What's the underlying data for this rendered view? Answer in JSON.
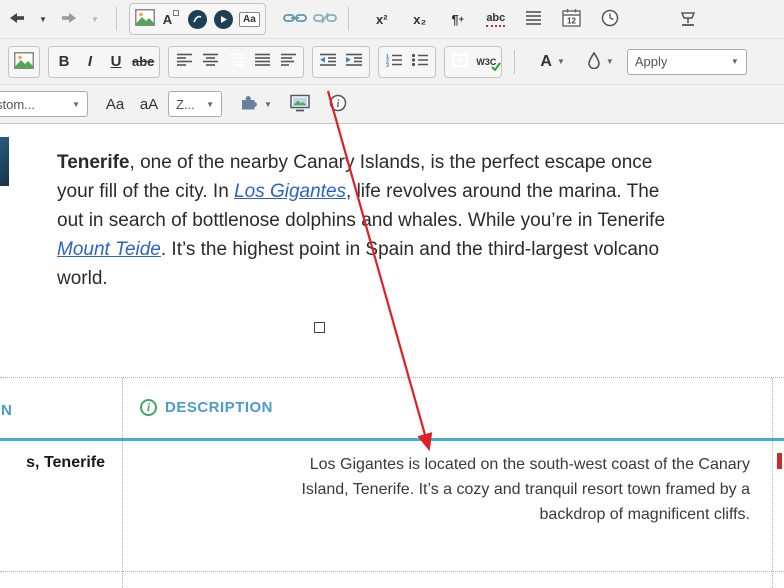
{
  "colors": {
    "toolbar_bg": "#f2f2f2",
    "active_teal": "#2ba5c9",
    "table_header_blue": "#4a9cc6",
    "table_rule_teal": "#41b1d2",
    "info_icon_green": "#3fa95f",
    "link_blue": "#2a63c8",
    "arrow_red": "#df1f26",
    "dark_circle_icon": "#1d4057"
  },
  "glyphs": {
    "caret_down": "▼",
    "info_i": "i",
    "numlist": [
      "1",
      "2",
      "3"
    ]
  },
  "icons": {
    "undo": "arrow-left",
    "redo": "arrow-right",
    "image_manager": "picture",
    "document_manager": "letter-a-with-box",
    "flash_manager": "dark-circle",
    "media_manager": "dark-circle-play",
    "template_manager": "aa-box",
    "hyperlink": "chain",
    "remove_link": "broken-chain",
    "horizontal_rule": "stacked-lines",
    "insert_date": "calendar",
    "insert_time": "clock",
    "org_chart": "podium",
    "align_left": "lines-left",
    "align_center": "lines-center",
    "align_right": "lines-right",
    "justify": "lines-justify",
    "align_none": "lines-mixed",
    "outdent": "left-arrow-lines",
    "indent": "right-arrow-lines",
    "numbered_list": "numbered-lines",
    "bullet_list": "bulleted-lines",
    "table_borders": "grid",
    "background_color": "droplet",
    "module": "puzzle-piece",
    "preview": "screen",
    "about": "circle-i",
    "description_header": "circle-i"
  },
  "toolbar_row1": {
    "document_manager_label": "A",
    "template_label": "Aa",
    "superscript_label": "x²",
    "subscript_label": "x₂",
    "pilcrow_label": "¶",
    "pilcrow_plus": "+",
    "spellcheck_label": "abc",
    "calendar_day": "12"
  },
  "toolbar_row2": {
    "bold_label": "B",
    "italic_label": "I",
    "underline_label": "U",
    "strikethrough_label": "abe",
    "validator_label": "W3C",
    "forecolor_label": "A",
    "apply_label": "Apply"
  },
  "toolbar_row3": {
    "custom_dropdown_label": "stom...",
    "uppercase_label": "Aa",
    "lowercase_label": "aA",
    "zoom_dropdown_label": "Z..."
  },
  "document": {
    "paragraph": {
      "line1_bold": "Tenerife",
      "line1_rest": ", one of the nearby Canary Islands, is the perfect escape once",
      "line2_pre": "your fill of the city. In ",
      "line2_link": "Los Gigantes",
      "line2_post": ", life revolves around the marina. The",
      "line3": "out in search of bottlenose dolphins and whales. While you’re in Tenerife",
      "line4_link": "Mount Teide",
      "line4_post": ". It’s the highest point in Spain and the third-largest volcano",
      "line5": "world."
    }
  },
  "table": {
    "header_left_partial": "N",
    "header_description": "DESCRIPTION",
    "row": {
      "location_partial": "s, Tenerife",
      "description_line1": "Los Gigantes is located on the south-west coast of the Canary",
      "description_line2": "Island, Tenerife. It’s a cozy and tranquil resort town framed by a",
      "description_line3": "backdrop of magnificent cliffs."
    }
  }
}
